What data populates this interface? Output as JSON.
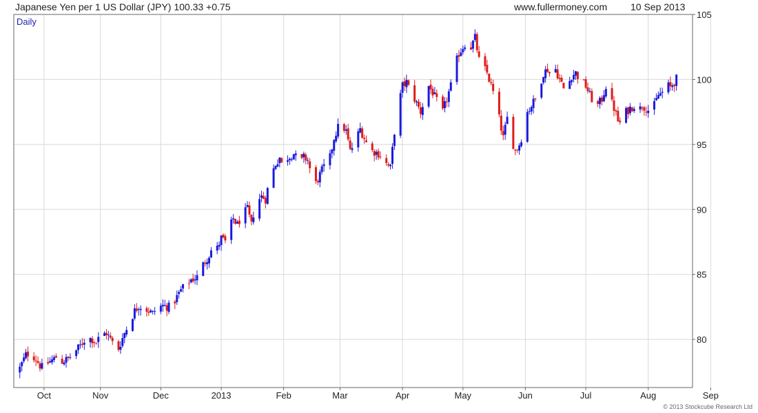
{
  "header": {
    "title": "Japanese Yen per 1 US Dollar (JPY) 100.33 +0.75",
    "site": "www.fullermoney.com",
    "date": "10 Sep 2013"
  },
  "footer": {
    "copyright": "© 2013 Stockcube Research Ltd"
  },
  "colors": {
    "up": "#1a1adc",
    "down": "#e01a1a",
    "grid": "#d8d8d8",
    "frame": "#666666",
    "label": "#2222aa"
  },
  "chart_data": {
    "type": "candlestick",
    "frequency_label": "Daily",
    "y_axis": {
      "side": "right",
      "ylim": [
        76.3,
        105.0
      ],
      "ticks": [
        80,
        85,
        90,
        95,
        100,
        105
      ]
    },
    "x_axis": {
      "labels": [
        "Oct",
        "Nov",
        "Dec",
        "2013",
        "Feb",
        "Mar",
        "Apr",
        "May",
        "Jun",
        "Jul",
        "Aug",
        "Sep"
      ],
      "label_positions_days": [
        12,
        40,
        70,
        100,
        131,
        159,
        190,
        220,
        251,
        281,
        312,
        343
      ]
    },
    "anchors": [
      [
        0,
        77.8
      ],
      [
        3,
        78.8
      ],
      [
        5,
        79.0
      ],
      [
        8,
        78.5
      ],
      [
        10,
        78.0
      ],
      [
        12,
        77.7
      ],
      [
        14,
        78.2
      ],
      [
        17,
        78.5
      ],
      [
        19,
        78.8
      ],
      [
        21,
        78.3
      ],
      [
        24,
        78.5
      ],
      [
        27,
        79.0
      ],
      [
        30,
        79.5
      ],
      [
        33,
        80.2
      ],
      [
        36,
        80.0
      ],
      [
        38,
        79.8
      ],
      [
        40,
        80.3
      ],
      [
        43,
        80.5
      ],
      [
        45,
        80.0
      ],
      [
        47,
        79.5
      ],
      [
        49,
        79.3
      ],
      [
        52,
        80.5
      ],
      [
        55,
        81.5
      ],
      [
        57,
        82.2
      ],
      [
        59,
        82.6
      ],
      [
        61,
        82.5
      ],
      [
        63,
        82.3
      ],
      [
        66,
        82.0
      ],
      [
        68,
        82.4
      ],
      [
        71,
        82.6
      ],
      [
        74,
        82.5
      ],
      [
        77,
        83.0
      ],
      [
        80,
        83.8
      ],
      [
        83,
        84.3
      ],
      [
        85,
        84.6
      ],
      [
        88,
        84.8
      ],
      [
        90,
        85.5
      ],
      [
        92,
        86.0
      ],
      [
        94,
        86.5
      ],
      [
        96,
        87.2
      ],
      [
        98,
        87.0
      ],
      [
        100,
        87.8
      ],
      [
        102,
        87.5
      ],
      [
        104,
        88.5
      ],
      [
        106,
        89.3
      ],
      [
        108,
        88.8
      ],
      [
        110,
        89.5
      ],
      [
        113,
        90.0
      ],
      [
        115,
        88.8
      ],
      [
        117,
        90.5
      ],
      [
        120,
        91.0
      ],
      [
        122,
        90.8
      ],
      [
        124,
        92.3
      ],
      [
        127,
        93.5
      ],
      [
        129,
        94.0
      ],
      [
        131,
        93.0
      ],
      [
        133,
        94.0
      ],
      [
        136,
        94.3
      ],
      [
        139,
        93.5
      ],
      [
        141,
        94.0
      ],
      [
        143,
        93.8
      ],
      [
        145,
        92.5
      ],
      [
        147,
        92.0
      ],
      [
        150,
        93.0
      ],
      [
        152,
        93.5
      ],
      [
        154,
        94.0
      ],
      [
        156,
        95.5
      ],
      [
        158,
        96.3
      ],
      [
        160,
        96.5
      ],
      [
        162,
        96.0
      ],
      [
        164,
        94.5
      ],
      [
        166,
        95.0
      ],
      [
        169,
        96.2
      ],
      [
        171,
        95.5
      ],
      [
        173,
        94.8
      ],
      [
        175,
        94.5
      ],
      [
        178,
        94.3
      ],
      [
        180,
        94.0
      ],
      [
        182,
        93.5
      ],
      [
        184,
        93.2
      ],
      [
        186,
        96.0
      ],
      [
        188,
        98.0
      ],
      [
        190,
        99.5
      ],
      [
        192,
        99.8
      ],
      [
        194,
        99.0
      ],
      [
        196,
        98.5
      ],
      [
        199,
        97.5
      ],
      [
        201,
        98.5
      ],
      [
        203,
        99.5
      ],
      [
        205,
        99.0
      ],
      [
        208,
        98.0
      ],
      [
        210,
        97.5
      ],
      [
        212,
        98.5
      ],
      [
        214,
        99.5
      ],
      [
        216,
        101.0
      ],
      [
        218,
        102.0
      ],
      [
        220,
        102.5
      ],
      [
        222,
        103.0
      ],
      [
        224,
        102.5
      ],
      [
        226,
        103.2
      ],
      [
        228,
        101.5
      ],
      [
        230,
        101.0
      ],
      [
        232,
        100.5
      ],
      [
        234,
        99.5
      ],
      [
        236,
        98.5
      ],
      [
        238,
        97.0
      ],
      [
        240,
        95.5
      ],
      [
        242,
        97.0
      ],
      [
        244,
        95.5
      ],
      [
        246,
        94.5
      ],
      [
        248,
        95.0
      ],
      [
        250,
        96.0
      ],
      [
        252,
        97.5
      ],
      [
        254,
        98.0
      ],
      [
        256,
        98.5
      ],
      [
        258,
        99.5
      ],
      [
        260,
        100.5
      ],
      [
        262,
        100.8
      ],
      [
        264,
        100.2
      ],
      [
        266,
        100.8
      ],
      [
        268,
        100.0
      ],
      [
        270,
        99.3
      ],
      [
        272,
        99.5
      ],
      [
        274,
        100.3
      ],
      [
        276,
        100.5
      ],
      [
        279,
        99.8
      ],
      [
        281,
        99.5
      ],
      [
        283,
        98.8
      ],
      [
        285,
        98.2
      ],
      [
        287,
        98.0
      ],
      [
        289,
        98.5
      ],
      [
        291,
        99.5
      ],
      [
        293,
        98.5
      ],
      [
        295,
        97.8
      ],
      [
        297,
        96.8
      ],
      [
        299,
        96.5
      ],
      [
        301,
        97.5
      ],
      [
        303,
        97.8
      ],
      [
        305,
        98.0
      ],
      [
        307,
        97.5
      ],
      [
        309,
        98.0
      ],
      [
        311,
        97.8
      ],
      [
        313,
        97.5
      ],
      [
        315,
        98.0
      ],
      [
        317,
        98.8
      ],
      [
        319,
        99.0
      ],
      [
        321,
        99.6
      ],
      [
        323,
        99.4
      ],
      [
        325,
        99.8
      ],
      [
        327,
        100.3
      ]
    ]
  }
}
